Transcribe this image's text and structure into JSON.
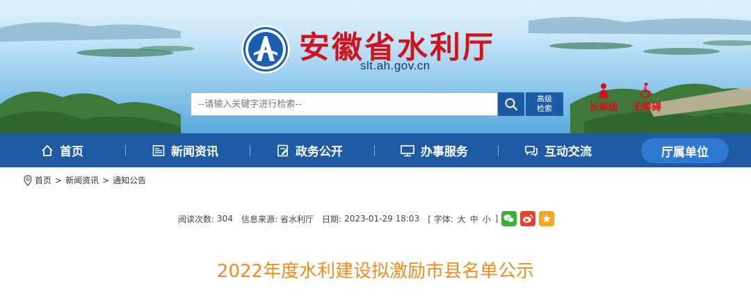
{
  "header": {
    "title": "安徽省水利厅",
    "url": "slt.ah.gov.cn",
    "search_placeholder": "--请输入关键字进行检索--",
    "advanced_search_line1": "高级",
    "advanced_search_line2": "检索",
    "elder_mode_label": "长辈版",
    "accessibility_label": "无障碍",
    "colors": {
      "brand_red": "#d0141c",
      "brand_blue": "#1f5aa4"
    }
  },
  "nav": {
    "items": [
      {
        "label": "首页",
        "icon": "home-icon"
      },
      {
        "label": "新闻资讯",
        "icon": "news-icon"
      },
      {
        "label": "政务公开",
        "icon": "document-edit-icon"
      },
      {
        "label": "办事服务",
        "icon": "monitor-icon"
      },
      {
        "label": "互动交流",
        "icon": "chat-icon"
      },
      {
        "label": "厅属单位",
        "icon": ""
      }
    ],
    "active_index": 5
  },
  "breadcrumb": {
    "items": [
      "首页",
      "新闻资讯",
      "通知公告"
    ],
    "separator": ">"
  },
  "meta": {
    "views_label": "阅读次数:",
    "views": "304",
    "source_label": "信息来源:",
    "source": "省水利厅",
    "date_label": "日期:",
    "date": "2023-01-29 18:03",
    "font_label": "[ 字体:",
    "font_large": "大",
    "font_medium": "中",
    "font_small": "小",
    "font_close": "]",
    "share_icons": [
      "wechat-icon",
      "weibo-icon",
      "favorite-icon"
    ]
  },
  "article": {
    "title": "2022年度水利建设拟激励市县名单公示"
  }
}
